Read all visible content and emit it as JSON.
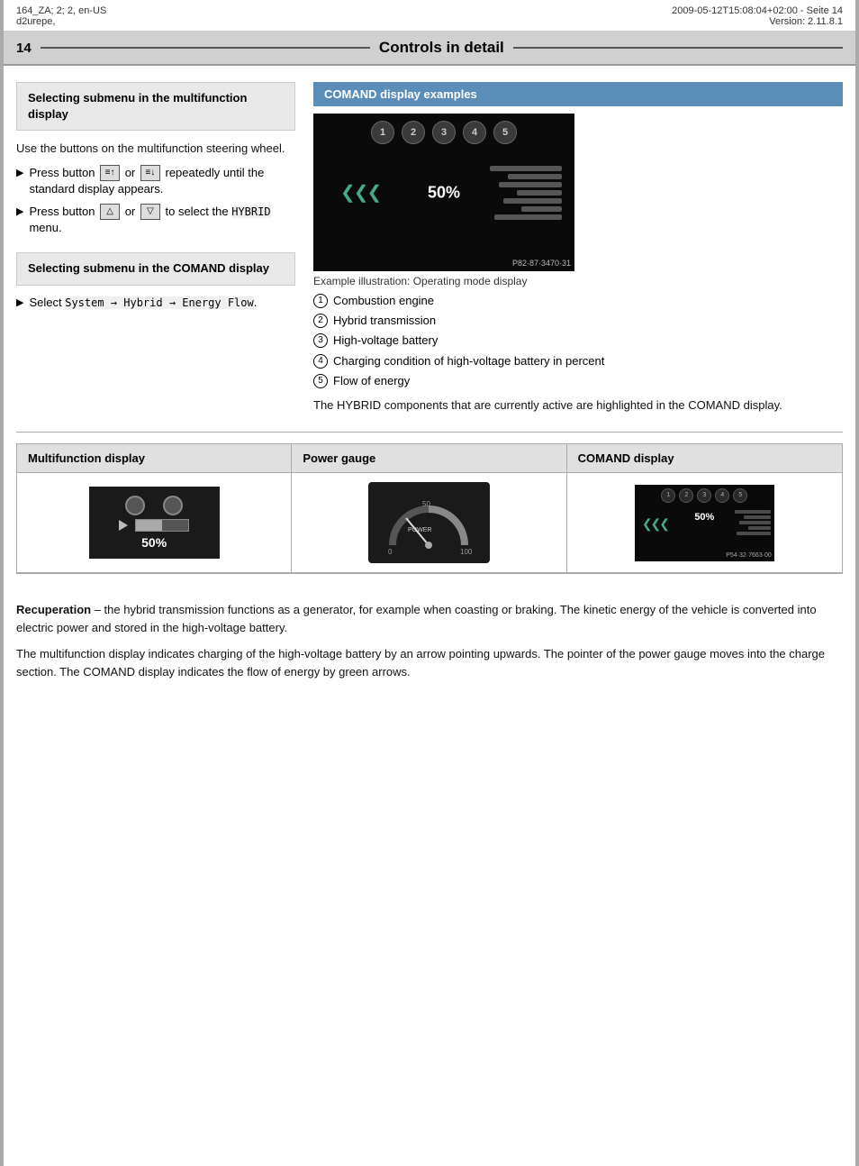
{
  "meta": {
    "left": "164_ZA; 2; 2, en-US\nd2urepe,",
    "left_line1": "164_ZA; 2; 2, en-US",
    "left_line2": "d2urepe,",
    "right_line1": "2009-05-12T15:08:04+02:00 - Seite 14",
    "right_line2": "Version: 2.11.8.1"
  },
  "header": {
    "page_number": "14",
    "title": "Controls in detail"
  },
  "left_section1": {
    "title": "Selecting submenu in the multifunction display",
    "body": "Use the buttons on the multifunction steering wheel.",
    "bullets": [
      {
        "text": "Press button",
        "rest": " or  repeatedly until the standard display appears."
      },
      {
        "text": "Press button",
        "rest": " or  to select the HYBRID menu."
      }
    ]
  },
  "left_section2": {
    "title": "Selecting submenu in the COMAND display",
    "bullet": "Select System → Hybrid → Energy Flow."
  },
  "right_section": {
    "title": "COMAND display examples",
    "img_id": "P82·87·3470·31",
    "caption": "Example illustration: Operating mode display",
    "numbered_items": [
      {
        "num": "1",
        "text": "Combustion engine"
      },
      {
        "num": "2",
        "text": "Hybrid transmission"
      },
      {
        "num": "3",
        "text": "High-voltage battery"
      },
      {
        "num": "4",
        "text": "Charging condition of high-voltage battery in percent"
      },
      {
        "num": "5",
        "text": "Flow of energy"
      }
    ],
    "body_text": "The HYBRID components that are currently active are highlighted in the COMAND display."
  },
  "bottom_table": {
    "col1_header": "Multifunction display",
    "col2_header": "Power gauge",
    "col3_header": "COMAND display",
    "img_id2": "P54·32·7663·00"
  },
  "bottom_text": {
    "para1_bold": "Recuperation",
    "para1_rest": " – the hybrid transmission functions as a generator, for example when coasting or braking. The kinetic energy of the vehicle is converted into electric power and stored in the high-voltage battery.",
    "para2": "The multifunction display indicates charging of the high-voltage battery by an arrow pointing upwards. The pointer of the power gauge moves into the charge section. The COMAND display indicates the flow of energy by green arrows."
  }
}
